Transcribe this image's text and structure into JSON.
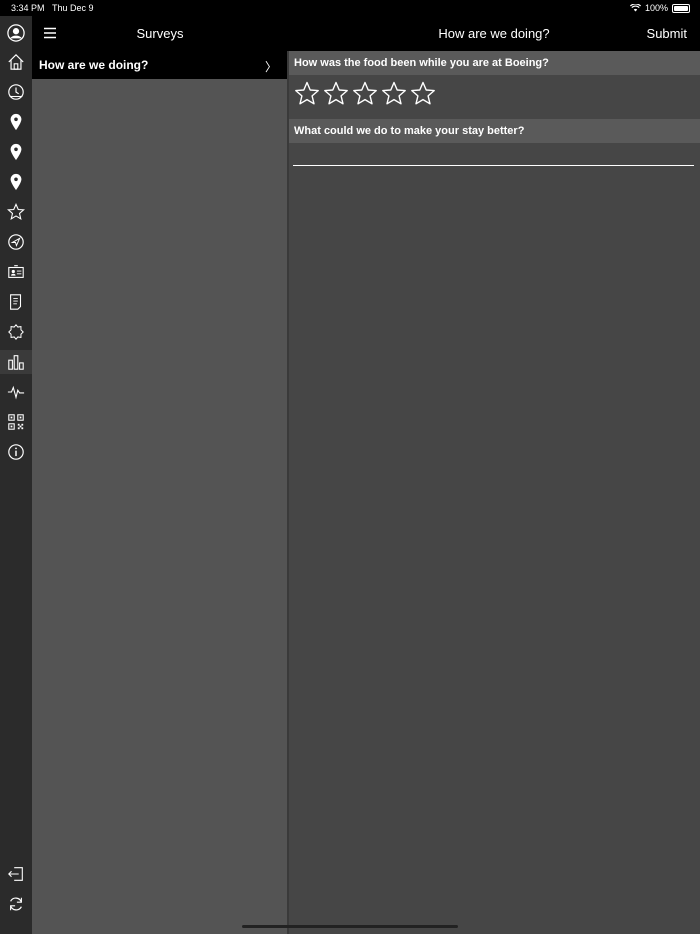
{
  "status_bar": {
    "time": "3:34 PM",
    "date": "Thu Dec 9",
    "battery": "100%"
  },
  "left_nav": {
    "title": "Surveys"
  },
  "right_nav": {
    "title": "How are we doing?",
    "submit_label": "Submit"
  },
  "survey_list": [
    {
      "label": "How are we doing?",
      "chevron": "〉"
    }
  ],
  "questions": [
    {
      "text": "How was the food been while you are at Boeing?",
      "type": "star-rating",
      "max_rating": 5,
      "rating": 0
    },
    {
      "text": "What could we do to make your stay better?",
      "type": "text",
      "value": ""
    }
  ],
  "sidebar_icons": [
    "profile-icon",
    "home-icon",
    "clock-icon",
    "location-pin-icon",
    "location-pin-icon",
    "location-pin-icon",
    "star-icon",
    "navigation-arrow-icon",
    "id-card-icon",
    "document-icon",
    "badge-icon",
    "bar-chart-icon",
    "activity-icon",
    "qr-code-icon",
    "info-icon",
    "logout-icon",
    "refresh-icon"
  ]
}
